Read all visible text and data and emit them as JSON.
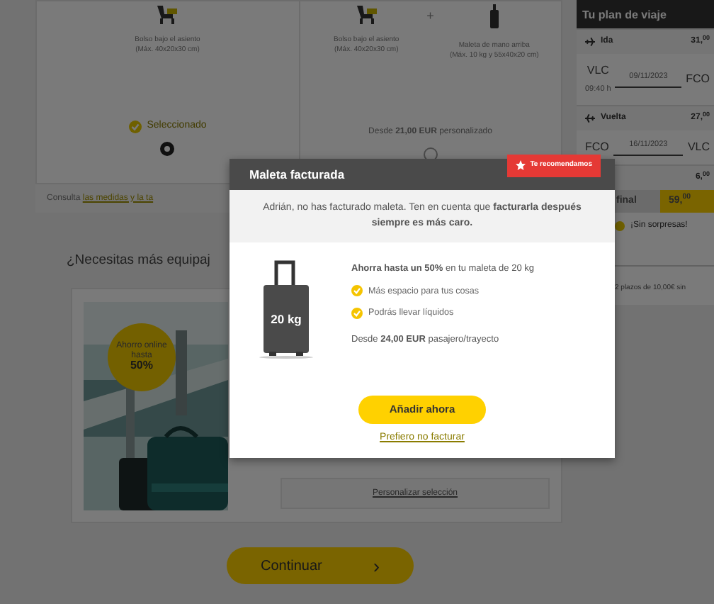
{
  "bag_options": [
    {
      "items": [
        {
          "name": "Bolso bajo el asiento",
          "size": "(Máx. 40x20x30 cm)",
          "kind": "underseat"
        }
      ],
      "status": "Seleccionado",
      "selected": true
    },
    {
      "items": [
        {
          "name": "Bolso bajo el asiento",
          "size": "(Máx. 40x20x30 cm)",
          "kind": "underseat"
        },
        {
          "name": "Maleta de mano arriba",
          "size": "(Máx. 10 kg y 55x40x20 cm)",
          "kind": "cabin"
        }
      ],
      "plus": "+",
      "price": "Desde **21,00 EUR** personalizado",
      "selected": false
    }
  ],
  "info_note": {
    "text": "Consulta",
    "link": "las medidas y la ta"
  },
  "more_luggage": {
    "heading": "¿Necesitas más equipaj",
    "promo": {
      "text": "Ahorro online hasta",
      "value": "50%"
    },
    "customize": "Personalizar selección"
  },
  "continue_button": {
    "label": "Continuar",
    "arrow": "›"
  },
  "sidebar": {
    "title": "Tu plan de viaje",
    "legs": [
      {
        "label": "Ida",
        "price": "31,$^{00}$",
        "from": "VLC",
        "from_time": "09:40 h",
        "date": "09/11/2023",
        "to": "FCO"
      },
      {
        "label": "Vuelta",
        "price": "27,$^{00}$",
        "from": "FCO",
        "date": "16/11/2023",
        "to": "VLC"
      }
    ],
    "fees": "6,$^{00}$",
    "total_label": "final",
    "total": "59,$^{00}$",
    "no_surprises": "¡Sin sorpresas!",
    "installments": "2 plazos de 10,00€ sin"
  },
  "modal": {
    "title": "Maleta facturada",
    "badge": "Te recomendamos",
    "message": "Adrián, no has facturado maleta. Ten en cuenta que **facturarla después siempre es más caro.**",
    "bag_label": "20 kg",
    "headline": "**Ahorra hasta un 50%** en tu maleta de 20 kg",
    "benefits": [
      "Más espacio para tus cosas",
      "Podrás llevar líquidos"
    ],
    "price": "Desde **24,00 EUR** pasajero/trayecto",
    "primary": "Añadir ahora",
    "secondary": "Prefiero no facturar"
  }
}
